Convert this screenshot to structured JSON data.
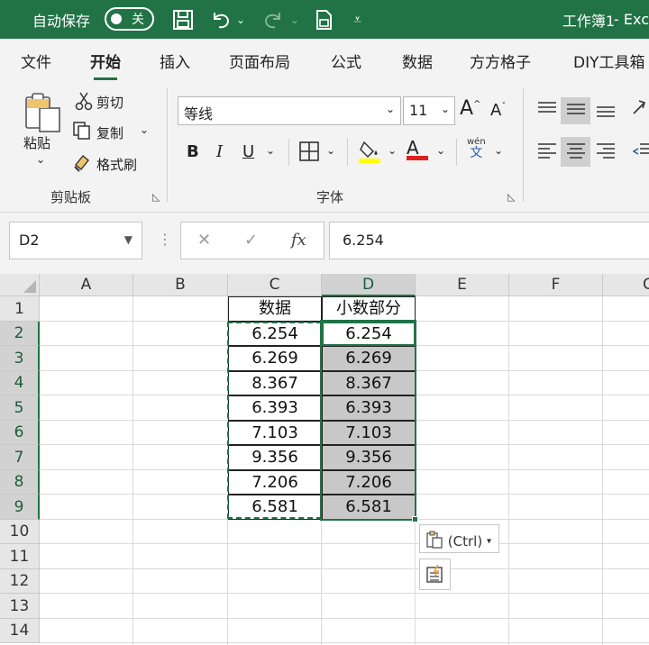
{
  "titlebar": {
    "autosave_label": "自动保存",
    "autosave_state": "关",
    "doc_title": "工作簿1",
    "app_title": "- Exc"
  },
  "tabs": [
    "文件",
    "开始",
    "插入",
    "页面布局",
    "公式",
    "数据",
    "方方格子",
    "DIY工具箱"
  ],
  "active_tab": "开始",
  "ribbon": {
    "clipboard": {
      "paste": "粘贴",
      "cut": "剪切",
      "copy": "复制",
      "format_painter": "格式刷",
      "group_label": "剪贴板"
    },
    "font": {
      "font_name": "等线",
      "font_size": "11",
      "bold": "B",
      "italic": "I",
      "underline": "U",
      "grow": "A",
      "shrink": "A",
      "font_color_glyph": "A",
      "wen_top": "wén",
      "wen_bottom": "文",
      "group_label": "字体"
    }
  },
  "formula_bar": {
    "name_box": "D2",
    "cancel": "✕",
    "confirm": "✓",
    "fx": "fx",
    "value": "6.254"
  },
  "grid": {
    "columns": [
      "A",
      "B",
      "C",
      "D",
      "E",
      "F",
      "G"
    ],
    "selected_column": "D",
    "rows": [
      "1",
      "2",
      "3",
      "4",
      "5",
      "6",
      "7",
      "8",
      "9",
      "10",
      "11",
      "12",
      "13",
      "14"
    ],
    "selected_rows": [
      "2",
      "3",
      "4",
      "5",
      "6",
      "7",
      "8",
      "9"
    ],
    "header_c": "数据",
    "header_d": "小数部分",
    "c_values": [
      "6.254",
      "6.269",
      "8.367",
      "6.393",
      "7.103",
      "9.356",
      "7.206",
      "6.581"
    ],
    "d_values": [
      "6.254",
      "6.269",
      "8.367",
      "6.393",
      "7.103",
      "9.356",
      "7.206",
      "6.581"
    ]
  },
  "paste_options": {
    "ctrl_label": "(Ctrl)"
  },
  "colors": {
    "accent": "#217346",
    "selection_fill": "#c8c8c8"
  }
}
